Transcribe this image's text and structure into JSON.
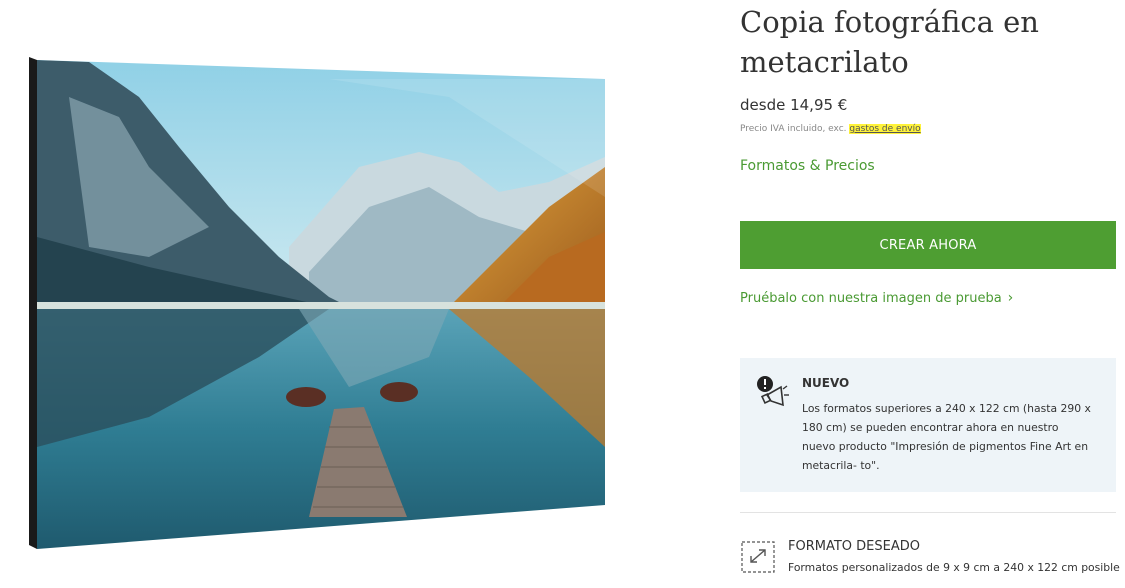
{
  "product": {
    "title": "Copia fotográfica en metacrilato",
    "price": "desde 14,95 €",
    "price_note": "Precio IVA incluido, exc.",
    "shipping_link": "gastos de envío",
    "formats_link": "Formatos & Precios",
    "create_button": "CREAR AHORA",
    "try_link": "Pruébalo con nuestra imagen de prueba",
    "try_chevron_icon": "chevron-right-icon",
    "image_alt_icon": "mountain-lake-photo"
  },
  "notice": {
    "icon": "megaphone-alert-icon",
    "title": "NUEVO",
    "body": "Los formatos superiores a 240 x 122 cm (hasta 290 x 180 cm) se pueden encontrar ahora en nuestro nuevo producto \"Impresión de pigmentos Fine Art en metacrila- to\"."
  },
  "format": {
    "icon": "resize-frame-icon",
    "title": "FORMATO DESEADO",
    "description": "Formatos personalizados de 9 x 9 cm a 240 x 122 cm posible"
  },
  "colors": {
    "accent_green": "#4e9e32",
    "link_green": "#4a9a33",
    "notice_bg": "#eef4f8",
    "highlight": "#fff33a"
  }
}
